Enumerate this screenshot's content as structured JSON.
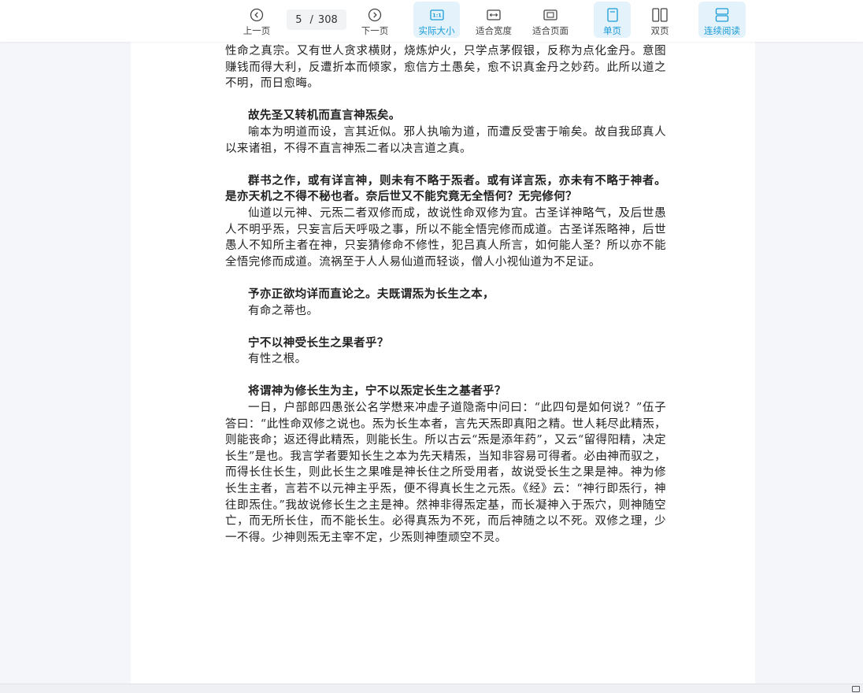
{
  "toolbar": {
    "prev_label": "上一页",
    "current_page": "5",
    "page_separator": "/",
    "total_pages": "308",
    "next_label": "下一页",
    "actual_size_label": "实际大小",
    "fit_width_label": "适合宽度",
    "fit_page_label": "适合页面",
    "single_page_label": "单页",
    "double_page_label": "双页",
    "continuous_label": "连续阅读",
    "accent_color": "#1a9bd7",
    "active_bg": "#e3f2fb"
  },
  "document": {
    "paragraphs": [
      {
        "text": "性命之真宗。又有世人贪求横财，烧炼炉火，只学点茅假银，反称为点化金丹。意图赚钱而得大利，反遭折本而倾家，愈信方土愚矣，愈不识真金丹之妙药。此所以道之不明，而日愈晦。",
        "bold": false,
        "indent": false
      },
      {
        "text": "故先圣又转机而直言神炁矣。",
        "bold": true,
        "indent": true
      },
      {
        "text": "喻本为明道而设，言其近似。邪人执喻为道，而遭反受害于喻矣。故自我邱真人以来诸祖，不得不直言神炁二者以决言道之真。",
        "bold": false,
        "indent": true
      },
      {
        "text": "群书之作，或有详言神，则未有不略于炁者。或有详言炁，亦未有不略于神者。是亦天机之不得不秘也者。奈后世又不能究竟无全悟何？无完修何？",
        "bold": true,
        "indent": true
      },
      {
        "text": "仙道以元神、元炁二者双修而成，故说性命双修为宜。古圣详神略气，及后世愚人不明乎炁，只妄言后天呼吸之事，所以不能全悟完修而成道。古圣详炁略神，后世愚人不知所主者在神，只妄猜修命不修性，犯吕真人所言，如何能人圣？所以亦不能全悟完修而成道。流祸至于人人易仙道而轻谈，僧人小视仙道为不足证。",
        "bold": false,
        "indent": true
      },
      {
        "text": "予亦正欲均详而直论之。夫既谓炁为长生之本，",
        "bold": true,
        "indent": true
      },
      {
        "text": "有命之蒂也。",
        "bold": false,
        "indent": true
      },
      {
        "text": "宁不以神受长生之果者乎？",
        "bold": true,
        "indent": true
      },
      {
        "text": "有性之根。",
        "bold": false,
        "indent": true
      },
      {
        "text": "将谓神为修长生为主，宁不以炁定长生之基者乎？",
        "bold": true,
        "indent": true
      },
      {
        "text": "一日，户部郎四愚张公名学懋来冲虚子道隐斋中问曰：“此四句是如何说？”伍子答曰：“此性命双修之说也。炁为长生本者，言先天炁即真阳之精。世人耗尽此精炁，则能丧命；返还得此精炁，则能长生。所以古云“炁是添年药”，又云“留得阳精，决定长生”是也。我言学者要知长生之本为先天精炁，当知非容易可得者。必由神而驭之，而得长住长生，则此长生之果唯是神长住之所受用者，故说受长生之果是神。神为修长生主者，言若不以元神主乎炁，便不得真长生之元炁。《经》云：“神行即炁行，神往即炁住。”我故说修长生之主是神。然神非得炁定基，而长凝神入于炁穴，则神随空亡，而无所长住，而不能长生。必得真炁为不死，而后神随之以不死。双修之理，少一不得。少神则炁无主宰不定，少炁则神堕顽空不灵。",
        "bold": false,
        "indent": true
      }
    ]
  }
}
